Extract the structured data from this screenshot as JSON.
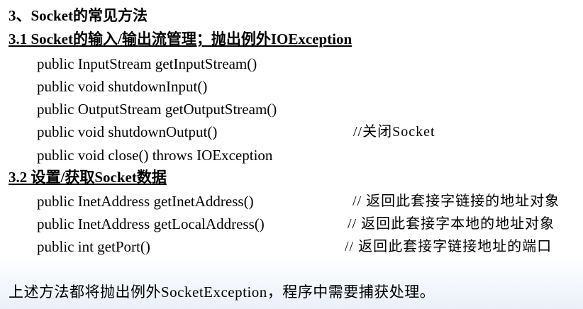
{
  "title": "3、Socket的常见方法",
  "sections": [
    {
      "heading": "3.1 Socket的输入/输出流管理；抛出例外IOException",
      "methods": [
        {
          "signature": "public InputStream getInputStream()",
          "comment": ""
        },
        {
          "signature": "public void shutdownInput()",
          "comment": ""
        },
        {
          "signature": "public OutputStream getOutputStream()",
          "comment": ""
        },
        {
          "signature": "public void shutdownOutput()",
          "comment": "//关闭Socket"
        },
        {
          "signature": "public void close() throws IOException",
          "comment": ""
        }
      ]
    },
    {
      "heading": "3.2 设置/获取Socket数据",
      "methods": [
        {
          "signature": "public InetAddress getInetAddress()",
          "comment": "// 返回此套接字链接的地址对象"
        },
        {
          "signature": "public InetAddress getLocalAddress()",
          "comment": "// 返回此套接字本地的地址对象"
        },
        {
          "signature": "public int getPort()",
          "comment": "// 返回此套接字链接地址的端口"
        }
      ]
    }
  ],
  "footer": "上述方法都将抛出例外SocketException，程序中需要捕获处理。"
}
